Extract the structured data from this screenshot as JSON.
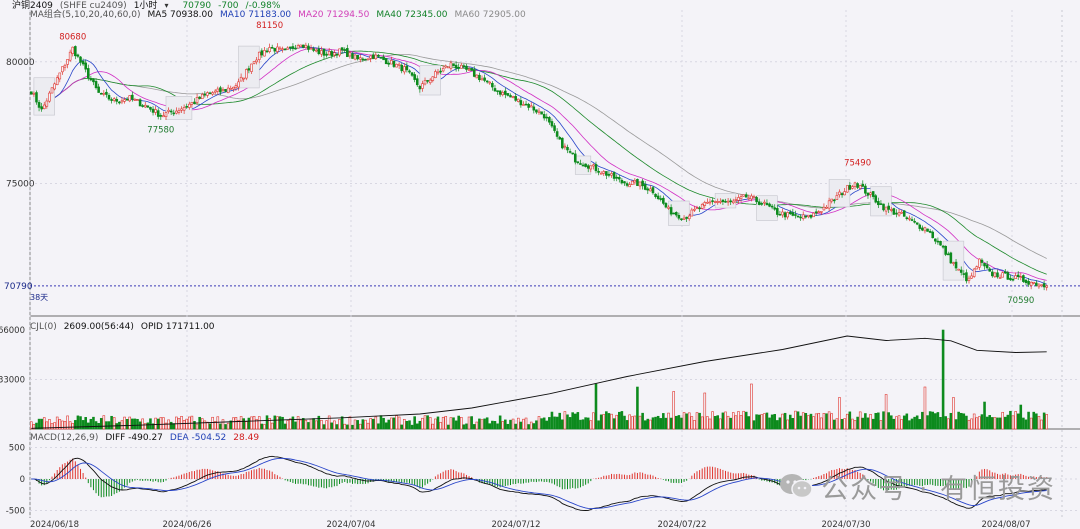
{
  "header": {
    "symbol": "沪铜2409",
    "exchange": "(SHFE cu2409)",
    "period": "1小时",
    "last": "70790",
    "change": "-700",
    "change_pct": "-0.98%",
    "ma_label": "MA组合(5,10,20,40,60,0)",
    "ma5": "MA5 70938.00",
    "ma10": "MA10 71183.00",
    "ma20": "MA20 71294.50",
    "ma40": "MA40 72345.00",
    "ma60": "MA60 72905.00"
  },
  "volume_panel": {
    "label": "CJL(0)",
    "volume": "2609.00(56:44)",
    "oi": "OPID 171711.00"
  },
  "macd_panel": {
    "label": "MACD(12,26,9)",
    "diff": "DIFF -490.27",
    "dea": "DEA -504.52",
    "macd": "28.49"
  },
  "watermark": "公众号 · 有恒投资",
  "colors": {
    "background": "#f4f3f8",
    "up_candle": "#e0362f",
    "down_candle": "#0c8a1d",
    "ma5": "#222222",
    "ma10": "#2a46c9",
    "ma20": "#d12fc4",
    "ma40": "#1e8a2c",
    "ma60": "#9a9a9a"
  },
  "chart_data": {
    "type": "candlestick",
    "period": "1小时",
    "x_ticks": [
      "2024/06/18",
      "2024/06/26",
      "2024/07/04",
      "2024/07/12",
      "2024/07/22",
      "2024/07/30",
      "2024/08/07"
    ],
    "y_ticks": [
      "80000",
      "75000"
    ],
    "price_range": [
      69800,
      81800
    ],
    "annotations": [
      {
        "text": "80680",
        "value": 80680
      },
      {
        "text": "77580",
        "value": 77580
      },
      {
        "text": "81150",
        "value": 81150
      },
      {
        "text": "75490",
        "value": 75490
      },
      {
        "text": "70590",
        "value": 70590
      }
    ],
    "last_price_label": "70790",
    "days_label": "38天",
    "volume_axis": [
      "66000",
      "33000"
    ],
    "macd_axis": [
      "500",
      "0",
      "-500"
    ],
    "close_anchors": [
      [
        0,
        78800
      ],
      [
        4,
        78000
      ],
      [
        10,
        79300
      ],
      [
        16,
        80550
      ],
      [
        20,
        79800
      ],
      [
        26,
        78700
      ],
      [
        32,
        78400
      ],
      [
        38,
        78500
      ],
      [
        44,
        78200
      ],
      [
        50,
        77800
      ],
      [
        56,
        78000
      ],
      [
        62,
        78300
      ],
      [
        68,
        78700
      ],
      [
        74,
        78800
      ],
      [
        80,
        79100
      ],
      [
        86,
        80100
      ],
      [
        92,
        80600
      ],
      [
        98,
        80400
      ],
      [
        104,
        80800
      ],
      [
        108,
        80500
      ],
      [
        114,
        80300
      ],
      [
        120,
        80450
      ],
      [
        126,
        80100
      ],
      [
        132,
        80250
      ],
      [
        138,
        80000
      ],
      [
        144,
        79700
      ],
      [
        150,
        78950
      ],
      [
        156,
        79500
      ],
      [
        162,
        79900
      ],
      [
        168,
        79650
      ],
      [
        174,
        79300
      ],
      [
        180,
        78800
      ],
      [
        186,
        78500
      ],
      [
        192,
        78200
      ],
      [
        198,
        77800
      ],
      [
        204,
        76700
      ],
      [
        210,
        76000
      ],
      [
        216,
        75700
      ],
      [
        222,
        75400
      ],
      [
        228,
        75050
      ],
      [
        234,
        75000
      ],
      [
        240,
        74700
      ],
      [
        246,
        73900
      ],
      [
        252,
        73600
      ],
      [
        258,
        74000
      ],
      [
        264,
        74300
      ],
      [
        270,
        74200
      ],
      [
        276,
        74450
      ],
      [
        282,
        74200
      ],
      [
        288,
        73800
      ],
      [
        294,
        73650
      ],
      [
        300,
        73600
      ],
      [
        306,
        74000
      ],
      [
        312,
        74550
      ],
      [
        318,
        75050
      ],
      [
        324,
        74500
      ],
      [
        330,
        73950
      ],
      [
        336,
        73700
      ],
      [
        342,
        73300
      ],
      [
        346,
        73100
      ],
      [
        352,
        72300
      ],
      [
        358,
        71400
      ],
      [
        362,
        71000
      ],
      [
        366,
        71800
      ],
      [
        370,
        71300
      ],
      [
        376,
        71200
      ],
      [
        382,
        71050
      ],
      [
        388,
        70900
      ],
      [
        392,
        70790
      ]
    ],
    "volume_line": [
      [
        0,
        500
      ],
      [
        40,
        2500
      ],
      [
        80,
        5000
      ],
      [
        120,
        7500
      ],
      [
        150,
        10000
      ],
      [
        170,
        14000
      ],
      [
        200,
        23500
      ],
      [
        230,
        35000
      ],
      [
        260,
        45000
      ],
      [
        290,
        53000
      ],
      [
        315,
        62000
      ],
      [
        330,
        59000
      ],
      [
        345,
        60500
      ],
      [
        355,
        58800
      ],
      [
        365,
        52500
      ],
      [
        380,
        51000
      ],
      [
        392,
        51500
      ]
    ],
    "volume_spikes": [
      [
        218,
        30000
      ],
      [
        234,
        28000
      ],
      [
        248,
        25000
      ],
      [
        260,
        24000
      ],
      [
        278,
        30000
      ],
      [
        312,
        21000
      ],
      [
        330,
        23000
      ],
      [
        345,
        28000
      ],
      [
        352,
        66000
      ],
      [
        356,
        21000
      ],
      [
        368,
        18000
      ],
      [
        382,
        16000
      ]
    ]
  }
}
